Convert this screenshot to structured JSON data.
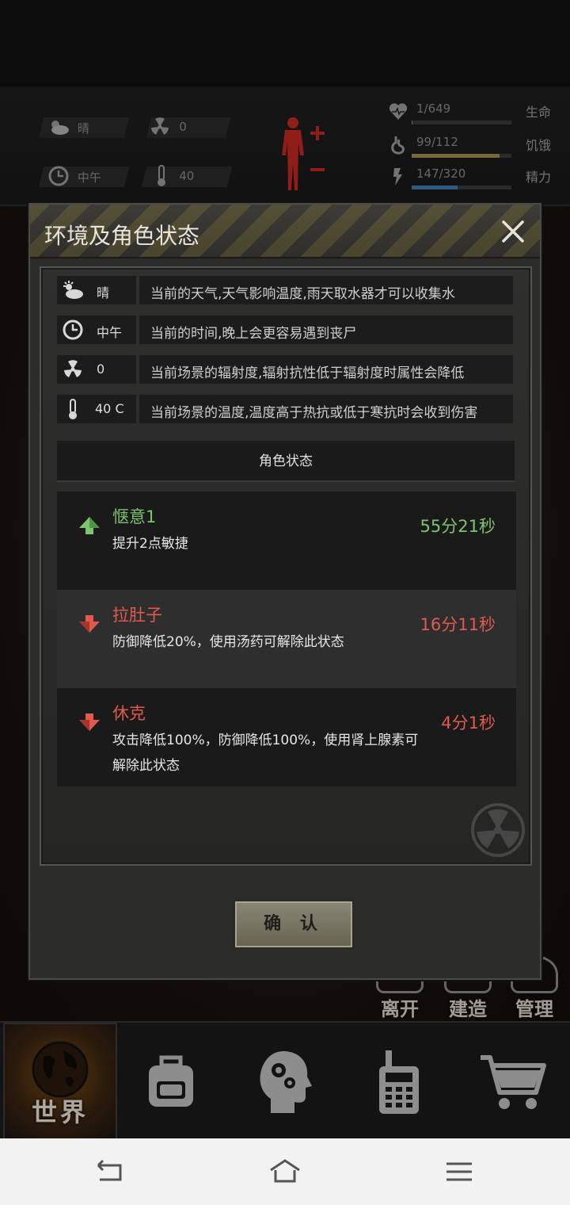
{
  "hud": {
    "weather": "晴",
    "radiation": "0",
    "time": "中午",
    "temperature": "40",
    "stats": [
      {
        "value": "1/649",
        "name": "生命",
        "fill": 0.0015,
        "color": "#888888",
        "icon": "heart-icon"
      },
      {
        "value": "99/112",
        "name": "饥饿",
        "fill": 0.88,
        "color": "#a08a4e",
        "icon": "stomach-icon"
      },
      {
        "value": "147/320",
        "name": "精力",
        "fill": 0.46,
        "color": "#3f7aa8",
        "icon": "energy-icon"
      }
    ]
  },
  "background_buttons": [
    "离开",
    "建造",
    "管理"
  ],
  "dialog": {
    "title": "环境及角色状态",
    "env": [
      {
        "icon": "weather-icon",
        "value": "晴",
        "desc": "当前的天气,天气影响温度,雨天取水器才可以收集水"
      },
      {
        "icon": "clock-icon",
        "value": "中午",
        "desc": "当前的时间,晚上会更容易遇到丧尸"
      },
      {
        "icon": "radiation-icon",
        "value": "0",
        "desc": "当前场景的辐射度,辐射抗性低于辐射度时属性会降低"
      },
      {
        "icon": "thermometer-icon",
        "value": "40 C",
        "desc": "当前场景的温度,温度高于热抗或低于寒抗时会收到伤害"
      }
    ],
    "section_title": "角色状态",
    "states": [
      {
        "type": "buff",
        "name": "惬意1",
        "desc": "提升2点敏捷",
        "time": "55分21秒"
      },
      {
        "type": "debuff",
        "name": "拉肚子",
        "desc": "防御降低20%，使用汤药可解除此状态",
        "time": "16分11秒"
      },
      {
        "type": "debuff",
        "name": "休克",
        "desc": "攻击降低100%，防御降低100%，使用肾上腺素可解除此状态",
        "time": "4分1秒"
      }
    ],
    "confirm_label": "确 认"
  },
  "nav": {
    "items": [
      {
        "label": "世界",
        "icon": "globe-icon",
        "active": true
      },
      {
        "label": "",
        "icon": "backpack-icon",
        "active": false
      },
      {
        "label": "",
        "icon": "head-gears-icon",
        "active": false
      },
      {
        "label": "",
        "icon": "walkie-talkie-icon",
        "active": false
      },
      {
        "label": "",
        "icon": "shopping-cart-icon",
        "active": false
      }
    ]
  },
  "colors": {
    "buff": "#7ec470",
    "debuff": "#e05a4e",
    "health_figure": "#c0271f"
  }
}
